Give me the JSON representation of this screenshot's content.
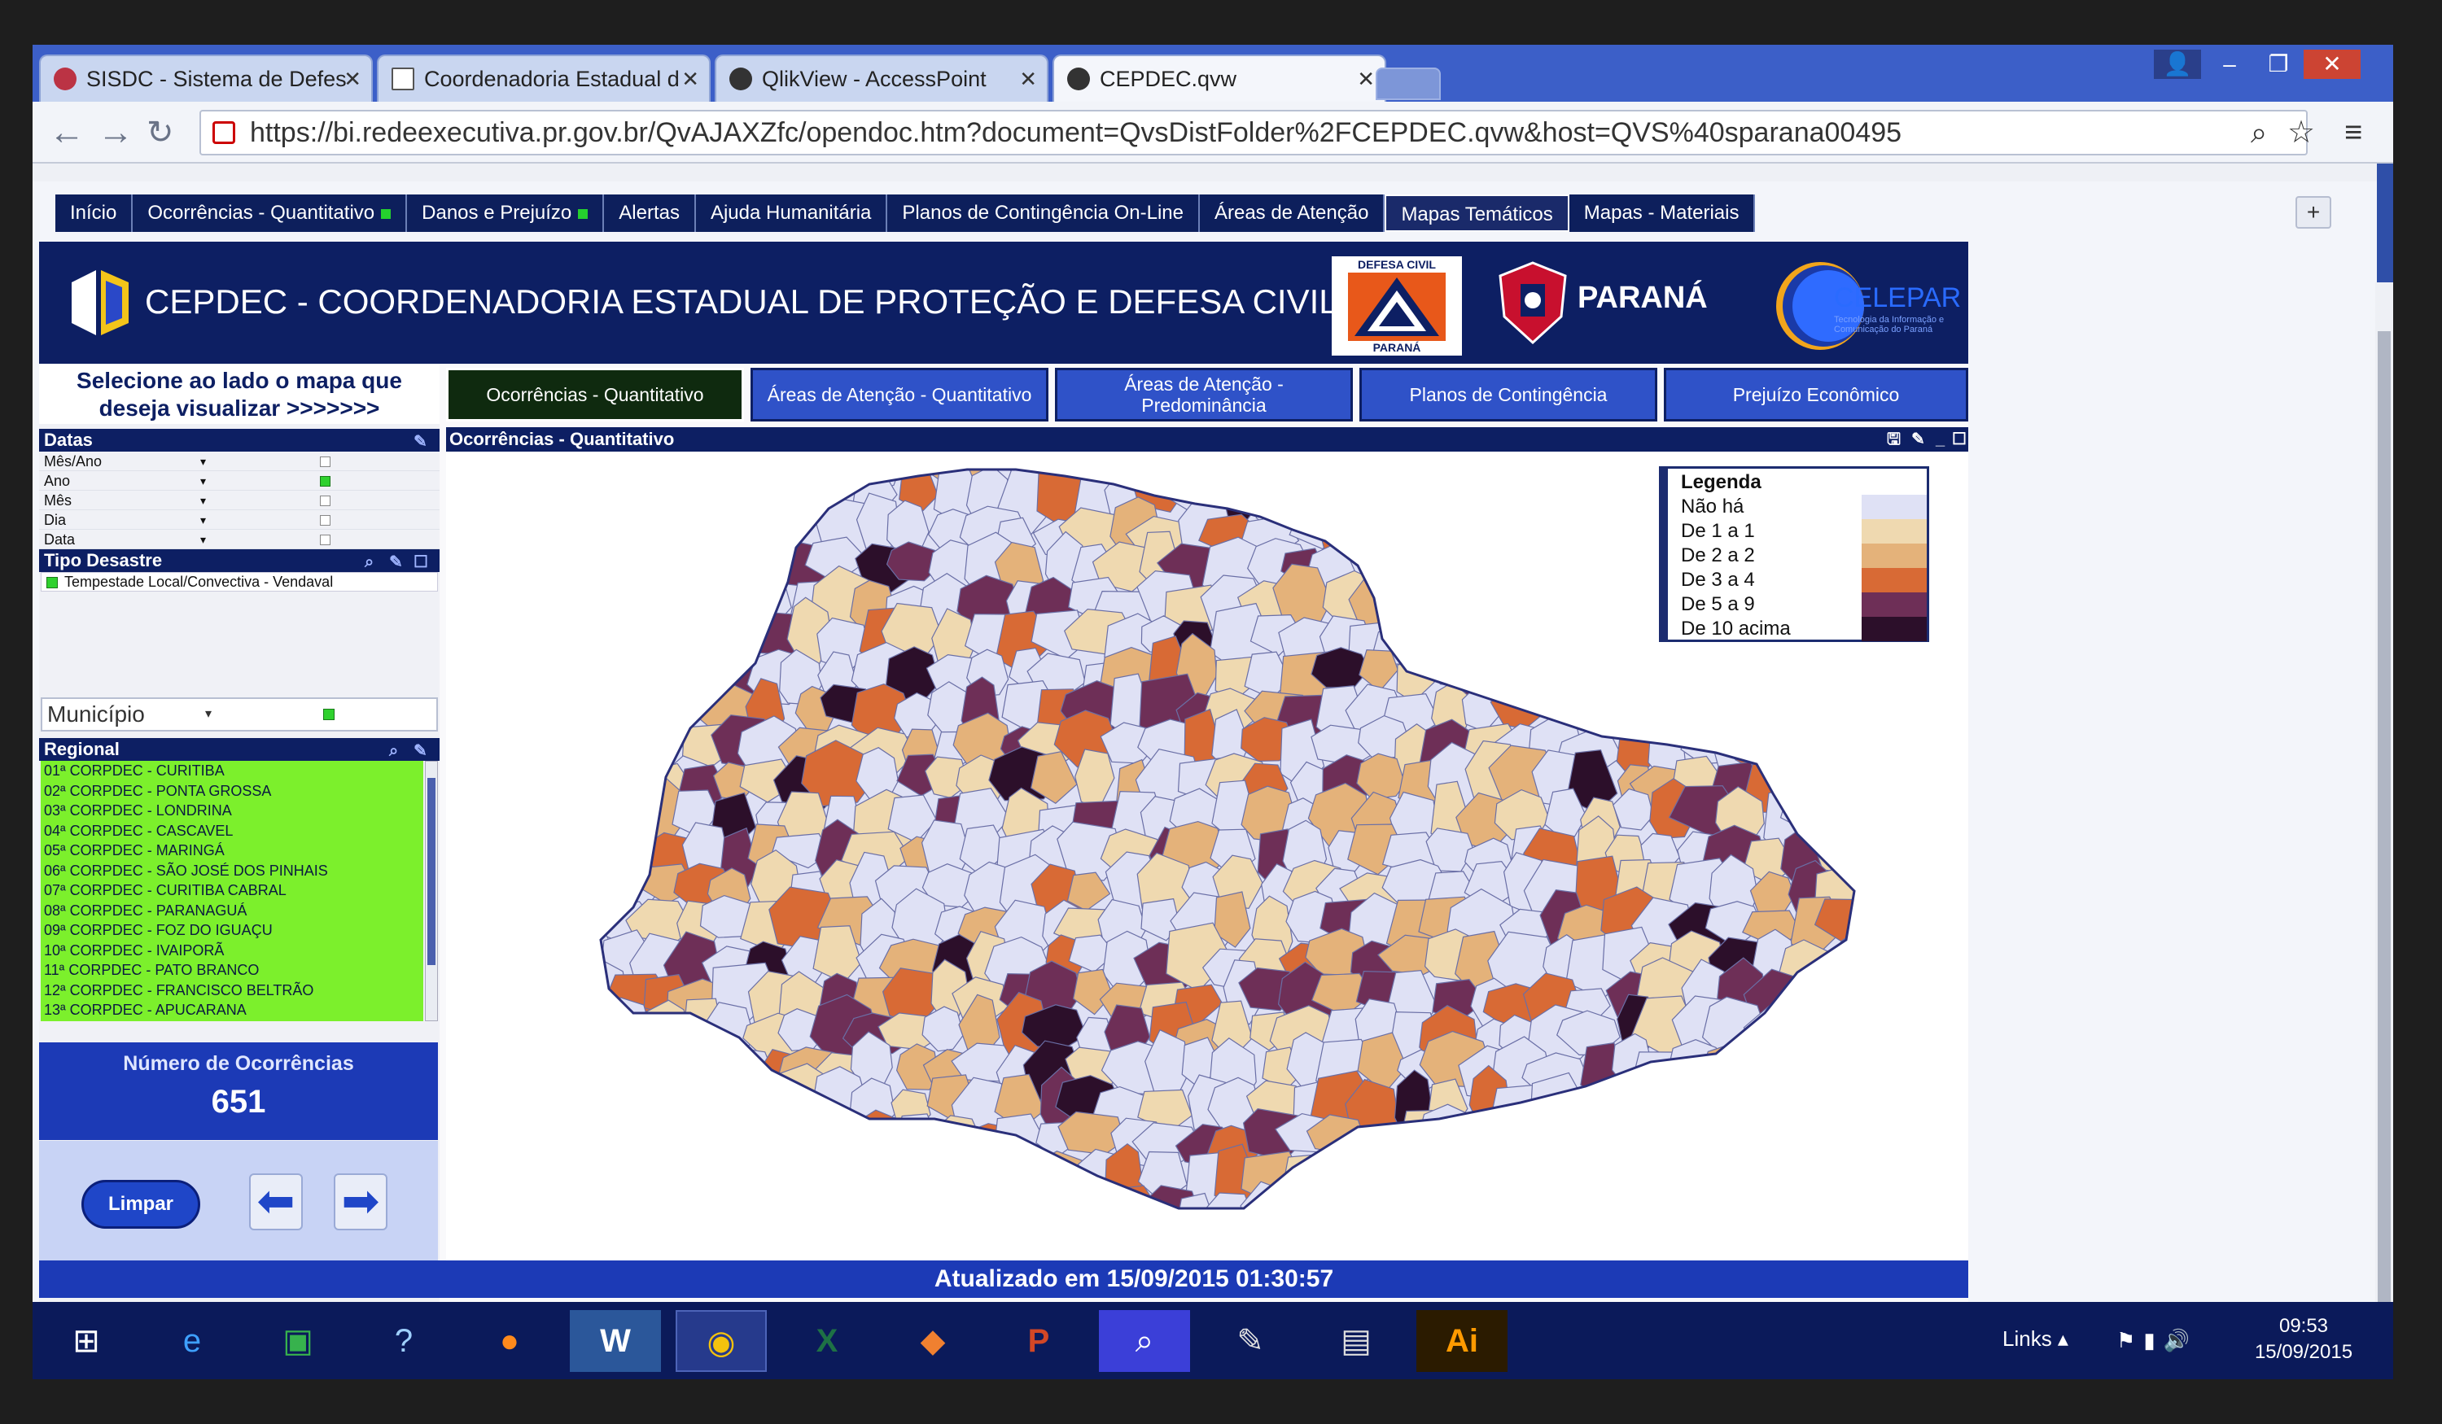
{
  "browser": {
    "tabs": [
      {
        "label": "SISDC - Sistema de Defes",
        "icon": "sisdc-favicon"
      },
      {
        "label": "Coordenadoria Estadual d",
        "icon": "document-favicon"
      },
      {
        "label": "QlikView - AccessPoint",
        "icon": "qlik-favicon"
      },
      {
        "label": "CEPDEC.qvw",
        "icon": "qlik-favicon"
      }
    ],
    "url": "https://bi.redeexecutiva.pr.gov.br/QvAJAXZfc/opendoc.htm?document=QvsDistFolder%2FCEPDEC.qvw&host=QVS%40sparana00495"
  },
  "qlik_tabs": [
    {
      "label": "Início",
      "dot": false
    },
    {
      "label": "Ocorrências - Quantitativo",
      "dot": true
    },
    {
      "label": "Danos e Prejuízo",
      "dot": true
    },
    {
      "label": "Alertas",
      "dot": false
    },
    {
      "label": "Ajuda Humanitária",
      "dot": false
    },
    {
      "label": "Planos de Contingência On-Line",
      "dot": false
    },
    {
      "label": "Áreas de Atenção",
      "dot": false
    },
    {
      "label": "Mapas Temáticos",
      "dot": false
    },
    {
      "label": "Mapas - Materiais",
      "dot": false
    }
  ],
  "header": {
    "title": "CEPDEC - COORDENADORIA ESTADUAL DE PROTEÇÃO E DEFESA CIVIL",
    "defesa_civil_top": "DEFESA CIVIL",
    "defesa_civil_bottom": "PARANÁ",
    "parana": "PARANÁ",
    "celepar": "CELEPAR",
    "celepar_sub": "Tecnologia da Informação e Comunicação do Paraná"
  },
  "left": {
    "select_msg": "Selecione ao lado o mapa que deseja visualizar >>>>>>>",
    "datas_title": "Datas",
    "datas_rows": [
      "Mês/Ano",
      "Ano",
      "Mês",
      "Dia",
      "Data"
    ],
    "tipo_title": "Tipo Desastre",
    "tipo_value": "Tempestade Local/Convectiva - Vendaval",
    "municipio": "Município",
    "regional_title": "Regional",
    "regional_items": [
      "01ª CORPDEC - CURITIBA",
      "02ª CORPDEC - PONTA GROSSA",
      "03ª CORPDEC - LONDRINA",
      "04ª CORPDEC - CASCAVEL",
      "05ª CORPDEC - MARINGÁ",
      "06ª CORPDEC - SÃO JOSÉ DOS PINHAIS",
      "07ª CORPDEC - CURITIBA CABRAL",
      "08ª CORPDEC - PARANAGUÁ",
      "09ª CORPDEC - FOZ DO IGUAÇU",
      "10ª CORPDEC - IVAIPORÃ",
      "11ª CORPDEC - PATO BRANCO",
      "12ª CORPDEC - FRANCISCO BELTRÃO",
      "13ª CORPDEC - APUCARANA"
    ],
    "occ_label": "Número de Ocorrências",
    "occ_value": "651",
    "limpar": "Limpar"
  },
  "map_buttons": [
    "Ocorrências - Quantitativo",
    "Áreas de Atenção - Quantitativo",
    "Áreas de Atenção - Predominância",
    "Planos de Contingência",
    "Prejuízo Econômico"
  ],
  "map": {
    "title": "Ocorrências - Quantitativo",
    "legend_title": "Legenda",
    "legend": [
      {
        "label": "Não há",
        "color": "#dfe1f5"
      },
      {
        "label": "De 1 a 1",
        "color": "#efd9b0"
      },
      {
        "label": "De 2 a 2",
        "color": "#e4b27a"
      },
      {
        "label": "De 3 a 4",
        "color": "#d86a35"
      },
      {
        "label": "De 5 a 9",
        "color": "#6e2f57"
      },
      {
        "label": "De 10 acima",
        "color": "#2c0f2a"
      }
    ]
  },
  "footer": "Atualizado em 15/09/2015 01:30:57",
  "taskbar": {
    "apps": [
      "windows-start-icon",
      "ie-icon",
      "store-icon",
      "help-icon",
      "firefox-icon",
      "word-icon",
      "chrome-icon",
      "excel-icon",
      "app-b-icon",
      "powerpoint-icon",
      "search-app-icon",
      "paint-icon",
      "file-explorer-icon",
      "illustrator-icon"
    ],
    "links": "Links",
    "time": "09:53",
    "date": "15/09/2015"
  }
}
